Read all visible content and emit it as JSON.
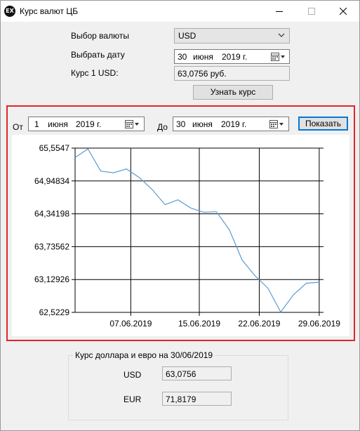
{
  "window": {
    "icon_text": "EX",
    "title": "Курс валют ЦБ"
  },
  "form": {
    "currency_label": "Выбор валюты",
    "currency_value": "USD",
    "date_label": "Выбрать дату",
    "date_day": "30",
    "date_month": "июня",
    "date_year": "2019 г.",
    "rate_label": "Курс 1 USD:",
    "rate_value": "63,0756 руб.",
    "get_rate_button": "Узнать курс"
  },
  "range": {
    "from_label": "От",
    "from_day": "1",
    "from_month": "июня",
    "from_year": "2019 г.",
    "to_label": "До",
    "to_day": "30",
    "to_month": "июня",
    "to_year": "2019 г.",
    "show_button": "Показать"
  },
  "chart_data": {
    "type": "line",
    "title": "",
    "xlabel": "",
    "ylabel": "",
    "grid": true,
    "legend": "none",
    "ylim": [
      62.5229,
      65.5547
    ],
    "xlim": [
      1,
      30
    ],
    "y_ticks": [
      "65,5547",
      "64,94834",
      "64,34198",
      "63,73562",
      "63,12926",
      "62,5229"
    ],
    "y_tick_values": [
      65.5547,
      64.94834,
      64.34198,
      63.73562,
      63.12926,
      62.5229
    ],
    "x_ticks": [
      "07.06.2019",
      "15.06.2019",
      "22.06.2019",
      "29.06.2019"
    ],
    "x_tick_values": [
      7.5,
      15.5,
      22.5,
      29.5
    ],
    "line_color": "#5b9bd5",
    "x": [
      1,
      2.5,
      4,
      5.5,
      7,
      8.5,
      10,
      11.5,
      13,
      14.5,
      16,
      17.5,
      19,
      20.5,
      22,
      23.5,
      25,
      26.5,
      28,
      29.5
    ],
    "values": [
      65.38,
      65.54,
      65.13,
      65.1,
      65.17,
      65.01,
      64.79,
      64.51,
      64.6,
      64.45,
      64.37,
      64.38,
      64.05,
      63.49,
      63.2,
      62.97,
      62.53,
      62.85,
      63.06,
      63.08
    ]
  },
  "summary": {
    "title": "Курс доллара и евро на 30/06/2019",
    "usd_label": "USD",
    "usd_value": "63,0756",
    "eur_label": "EUR",
    "eur_value": "71,8179"
  }
}
